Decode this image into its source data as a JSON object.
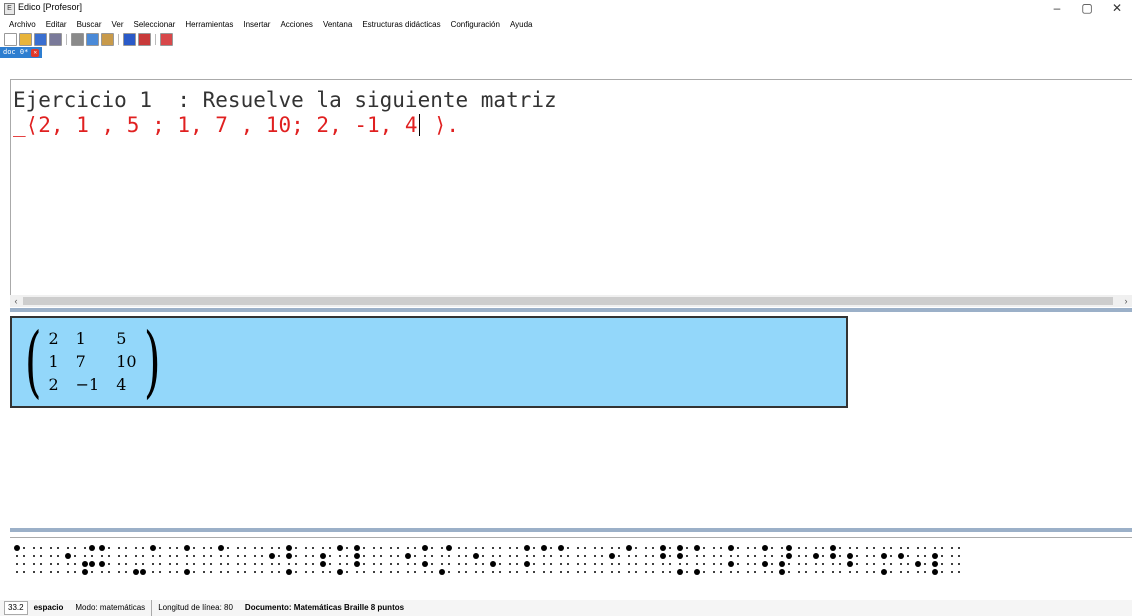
{
  "window": {
    "title": "Edico [Profesor]",
    "app_icon": "edico-app-icon",
    "controls": {
      "minimize": "–",
      "maximize": "▢",
      "close": "✕"
    }
  },
  "menu": [
    "Archivo",
    "Editar",
    "Buscar",
    "Ver",
    "Seleccionar",
    "Herramientas",
    "Insertar",
    "Acciones",
    "Ventana",
    "Estructuras didácticas",
    "Configuración",
    "Ayuda"
  ],
  "toolbar": {
    "buttons": [
      {
        "icon": "new-document-icon",
        "color": "#ffffff"
      },
      {
        "icon": "open-folder-icon",
        "color": "#e8b43a"
      },
      {
        "icon": "save-icon",
        "color": "#3a6fd0"
      },
      {
        "icon": "print-icon",
        "color": "#7a7a9a"
      },
      {
        "icon": "cut-icon",
        "color": "#8a8a8a"
      },
      {
        "icon": "copy-icon",
        "color": "#4a8ad8"
      },
      {
        "icon": "paste-icon",
        "color": "#c89a4a"
      },
      {
        "icon": "undo-icon",
        "color": "#2a5ac8"
      },
      {
        "icon": "redo-icon",
        "color": "#c83a3a"
      },
      {
        "icon": "pdf-icon",
        "color": "#d8484a"
      }
    ]
  },
  "tab": {
    "label": "doc 0*",
    "close_icon": "close-tab-icon"
  },
  "editor": {
    "line1": "Ejercicio 1  : Resuelve la siguiente matriz",
    "line2_before_caret": "_⟨2, 1 , 5 ; 1, 7 , 10; 2, -1, 4",
    "line2_after_caret": " ⟩."
  },
  "preview": {
    "matrix": [
      [
        "2",
        "1",
        "5"
      ],
      [
        "1",
        "7",
        "10"
      ],
      [
        "2",
        "−1",
        "4"
      ]
    ],
    "left_paren": "(",
    "right_paren": ")",
    "background": "#93d7fa"
  },
  "braille": {
    "cells": [
      [
        1,
        0,
        0,
        0,
        0,
        0,
        0,
        0
      ],
      [
        0,
        0,
        0,
        0,
        0,
        0,
        0,
        0
      ],
      [
        0,
        0,
        0,
        0,
        0,
        0,
        0,
        0
      ],
      [
        0,
        1,
        0,
        0,
        0,
        0,
        0,
        0
      ],
      [
        0,
        0,
        1,
        1,
        1,
        0,
        1,
        0
      ],
      [
        1,
        0,
        1,
        0,
        0,
        0,
        0,
        0
      ],
      [
        0,
        0,
        0,
        0,
        0,
        0,
        0,
        0
      ],
      [
        0,
        0,
        0,
        1,
        0,
        0,
        0,
        1
      ],
      [
        1,
        0,
        0,
        0,
        0,
        0,
        0,
        0
      ],
      [
        0,
        0,
        0,
        0,
        0,
        0,
        0,
        0
      ],
      [
        1,
        0,
        0,
        1,
        0,
        0,
        0,
        0
      ],
      [
        0,
        0,
        0,
        0,
        0,
        0,
        0,
        0
      ],
      [
        1,
        0,
        0,
        0,
        0,
        0,
        0,
        0
      ],
      [
        0,
        0,
        0,
        0,
        0,
        0,
        0,
        0
      ],
      [
        0,
        0,
        0,
        0,
        0,
        0,
        0,
        0
      ],
      [
        0,
        1,
        0,
        0,
        0,
        0,
        0,
        0
      ],
      [
        1,
        1,
        0,
        1,
        0,
        0,
        0,
        0
      ],
      [
        0,
        0,
        0,
        0,
        0,
        0,
        0,
        0
      ],
      [
        0,
        1,
        1,
        0,
        0,
        0,
        0,
        0
      ],
      [
        1,
        0,
        0,
        1,
        0,
        0,
        0,
        0
      ],
      [
        1,
        1,
        1,
        0,
        0,
        0,
        0,
        0
      ],
      [
        0,
        0,
        0,
        0,
        0,
        0,
        0,
        0
      ],
      [
        0,
        0,
        0,
        0,
        0,
        0,
        0,
        0
      ],
      [
        0,
        1,
        0,
        0,
        0,
        0,
        0,
        0
      ],
      [
        1,
        0,
        1,
        0,
        0,
        0,
        0,
        0
      ],
      [
        0,
        0,
        0,
        1,
        1,
        0,
        0,
        0
      ],
      [
        0,
        0,
        0,
        0,
        0,
        0,
        0,
        0
      ],
      [
        0,
        1,
        0,
        0,
        0,
        0,
        0,
        0
      ],
      [
        0,
        0,
        1,
        0,
        0,
        0,
        0,
        0
      ],
      [
        0,
        0,
        0,
        0,
        0,
        0,
        0,
        0
      ],
      [
        1,
        0,
        1,
        0,
        0,
        0,
        0,
        0
      ],
      [
        1,
        0,
        0,
        0,
        0,
        0,
        0,
        0
      ],
      [
        1,
        0,
        0,
        0,
        0,
        0,
        0,
        0
      ],
      [
        0,
        0,
        0,
        0,
        0,
        0,
        0,
        0
      ],
      [
        0,
        0,
        0,
        0,
        0,
        0,
        0,
        0
      ],
      [
        0,
        1,
        0,
        0,
        0,
        0,
        0,
        0
      ],
      [
        1,
        0,
        0,
        0,
        0,
        0,
        0,
        0
      ],
      [
        0,
        0,
        0,
        0,
        0,
        0,
        0,
        0
      ],
      [
        1,
        1,
        0,
        0,
        0,
        0,
        0,
        0
      ],
      [
        1,
        1,
        0,
        1,
        0,
        0,
        0,
        0
      ],
      [
        1,
        0,
        0,
        1,
        0,
        0,
        0,
        0
      ],
      [
        0,
        0,
        0,
        0,
        0,
        0,
        0,
        0
      ],
      [
        1,
        0,
        1,
        0,
        0,
        0,
        0,
        0
      ],
      [
        0,
        0,
        0,
        0,
        0,
        0,
        0,
        0
      ],
      [
        1,
        0,
        1,
        0,
        0,
        0,
        0,
        0
      ],
      [
        0,
        0,
        1,
        1,
        1,
        1,
        0,
        0
      ],
      [
        0,
        0,
        0,
        0,
        0,
        0,
        0,
        0
      ],
      [
        0,
        1,
        0,
        0,
        0,
        0,
        0,
        0
      ],
      [
        1,
        1,
        0,
        0,
        0,
        0,
        0,
        0
      ],
      [
        0,
        1,
        1,
        0,
        0,
        0,
        0,
        0
      ],
      [
        0,
        0,
        0,
        0,
        0,
        0,
        0,
        0
      ],
      [
        0,
        1,
        0,
        1,
        0,
        0,
        0,
        0
      ],
      [
        0,
        1,
        0,
        0,
        0,
        0,
        0,
        0
      ],
      [
        0,
        0,
        1,
        0,
        0,
        0,
        0,
        0
      ],
      [
        0,
        1,
        1,
        1,
        0,
        0,
        0,
        0
      ],
      [
        0,
        0,
        0,
        0,
        0,
        0,
        0,
        0
      ]
    ]
  },
  "status": {
    "position": "33.2",
    "key": "espacio",
    "mode": "Modo: matemáticas",
    "line_length": "Longitud de línea: 80",
    "document": "Documento: Matemáticas  Braille 8 puntos"
  }
}
